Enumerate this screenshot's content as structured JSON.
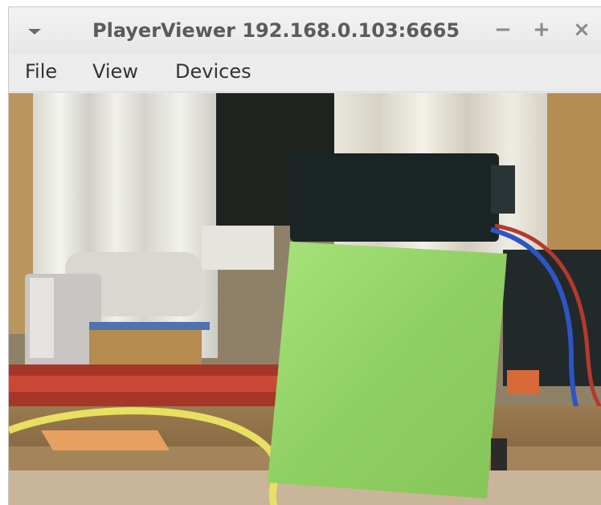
{
  "window": {
    "title": "PlayerViewer 192.168.0.103:6665",
    "controls": {
      "minimize": "−",
      "maximize": "+",
      "close": "×"
    },
    "menu_icon": "window-menu-arrow-icon"
  },
  "menubar": {
    "items": [
      {
        "label": "File"
      },
      {
        "label": "View"
      },
      {
        "label": "Devices"
      }
    ]
  },
  "camera_feed": {
    "content": "live-camera-image"
  }
}
